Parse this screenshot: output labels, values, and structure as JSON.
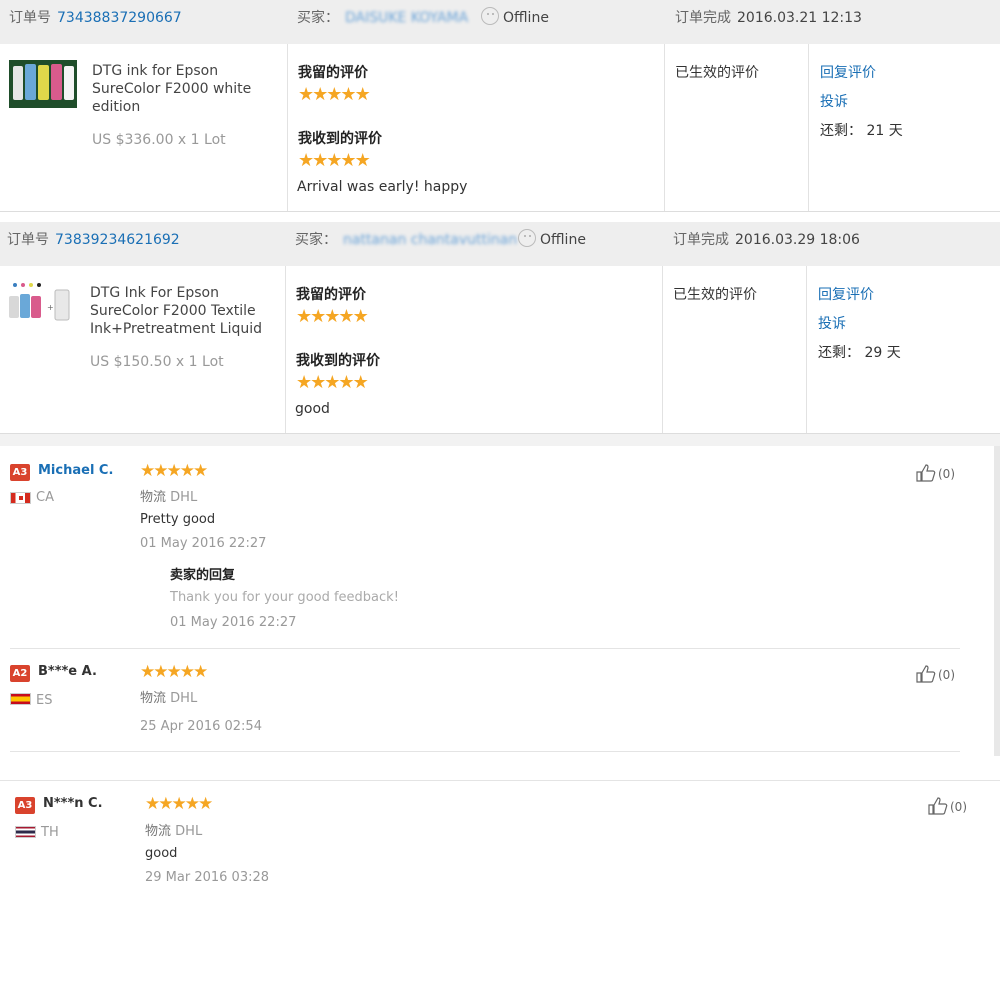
{
  "orders": [
    {
      "order_label": "订单号",
      "order_number": "73438837290667",
      "buyer_label": "买家：",
      "buyer_name": "DAISUKE KOYAMA",
      "status": "Offline",
      "complete_label": "订单完成",
      "complete_time": "2016.03.21 12:13",
      "product_name": "DTG ink for Epson SureColor F2000 white edition",
      "price": "US $336.00 x 1 Lot",
      "my_review_label": "我留的评价",
      "my_stars": 5,
      "received_label": "我收到的评价",
      "received_stars": 5,
      "received_text": "Arrival was early! happy",
      "state": "已生效的评价",
      "reply_link": "回复评价",
      "complain_link": "投诉",
      "remaining_label": "还剩：",
      "remaining_value": "21 天"
    },
    {
      "order_label": "订单号",
      "order_number": "73839234621692",
      "buyer_label": "买家：",
      "buyer_name": "nattanan chantavuttinan",
      "status": "Offline",
      "complete_label": "订单完成",
      "complete_time": "2016.03.29 18:06",
      "product_name": "DTG Ink For Epson SureColor F2000 Textile Ink+Pretreatment Liquid",
      "price": "US $150.50 x 1 Lot",
      "my_review_label": "我留的评价",
      "my_stars": 5,
      "received_label": "我收到的评价",
      "received_stars": 5,
      "received_text": "good",
      "state": "已生效的评价",
      "reply_link": "回复评价",
      "complain_link": "投诉",
      "remaining_label": "还剩：",
      "remaining_value": "29 天"
    }
  ],
  "reviews": [
    {
      "badge": "A3",
      "name": "Michael C.",
      "country": "CA",
      "stars": 5,
      "logistics_label": "物流",
      "logistics": "DHL",
      "text": "Pretty good",
      "date": "01 May 2016 22:27",
      "seller_reply_label": "卖家的回复",
      "seller_reply": "Thank you for your good feedback!",
      "reply_date": "01 May 2016 22:27",
      "likes": "(0)"
    },
    {
      "badge": "A2",
      "name": "B***e A.",
      "country": "ES",
      "stars": 5,
      "logistics_label": "物流",
      "logistics": "DHL",
      "text": "",
      "date": "25 Apr 2016 02:54",
      "likes": "(0)"
    },
    {
      "badge": "A3",
      "name": "N***n C.",
      "country": "TH",
      "stars": 5,
      "logistics_label": "物流",
      "logistics": "DHL",
      "text": "good",
      "date": "29 Mar 2016 03:28",
      "likes": "(0)"
    }
  ],
  "icons": {
    "star": "star-icon",
    "smiley": "smiley-icon",
    "thumb": "thumbs-up-icon"
  },
  "colors": {
    "star": "#f5a623",
    "link": "#1a6fb5",
    "badge": "#d9432d"
  }
}
